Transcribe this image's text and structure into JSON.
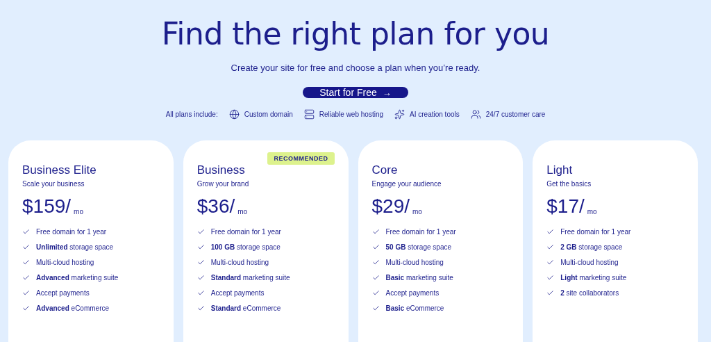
{
  "hero": {
    "title": "Find the right plan for you",
    "subtitle": "Create your site for free and choose a plan when you’re ready.",
    "cta": {
      "label": "Start for Free",
      "arrow": "→"
    }
  },
  "includes": {
    "label": "All plans include:",
    "items": [
      {
        "label": "Custom domain"
      },
      {
        "label": "Reliable web hosting"
      },
      {
        "label": "AI creation tools"
      },
      {
        "label": "24/7 customer care"
      }
    ]
  },
  "plans": [
    {
      "name": "Business Elite",
      "tagline": "Scale your business",
      "price": "$159/",
      "period": "mo",
      "features": [
        "Free domain for 1 year",
        "**Unlimited** storage space",
        "Multi-cloud hosting",
        "**Advanced** marketing suite",
        "Accept payments",
        "**Advanced** eCommerce"
      ]
    },
    {
      "name": "Business",
      "tagline": "Grow your brand",
      "price": "$36/",
      "period": "mo",
      "badge": "RECOMMENDED",
      "features": [
        "Free domain for 1 year",
        "**100 GB** storage space",
        "Multi-cloud hosting",
        "**Standard** marketing suite",
        "Accept payments",
        "**Standard** eCommerce"
      ]
    },
    {
      "name": "Core",
      "tagline": "Engage your audience",
      "price": "$29/",
      "period": "mo",
      "features": [
        "Free domain for 1 year",
        "**50 GB** storage space",
        "Multi-cloud hosting",
        "**Basic** marketing suite",
        "Accept payments",
        "**Basic** eCommerce"
      ]
    },
    {
      "name": "Light",
      "tagline": "Get the basics",
      "price": "$17/",
      "period": "mo",
      "features": [
        "Free domain for 1 year",
        "**2 GB** storage space",
        "Multi-cloud hosting",
        "**Light** marketing suite",
        "**2** site collaborators"
      ]
    }
  ]
}
